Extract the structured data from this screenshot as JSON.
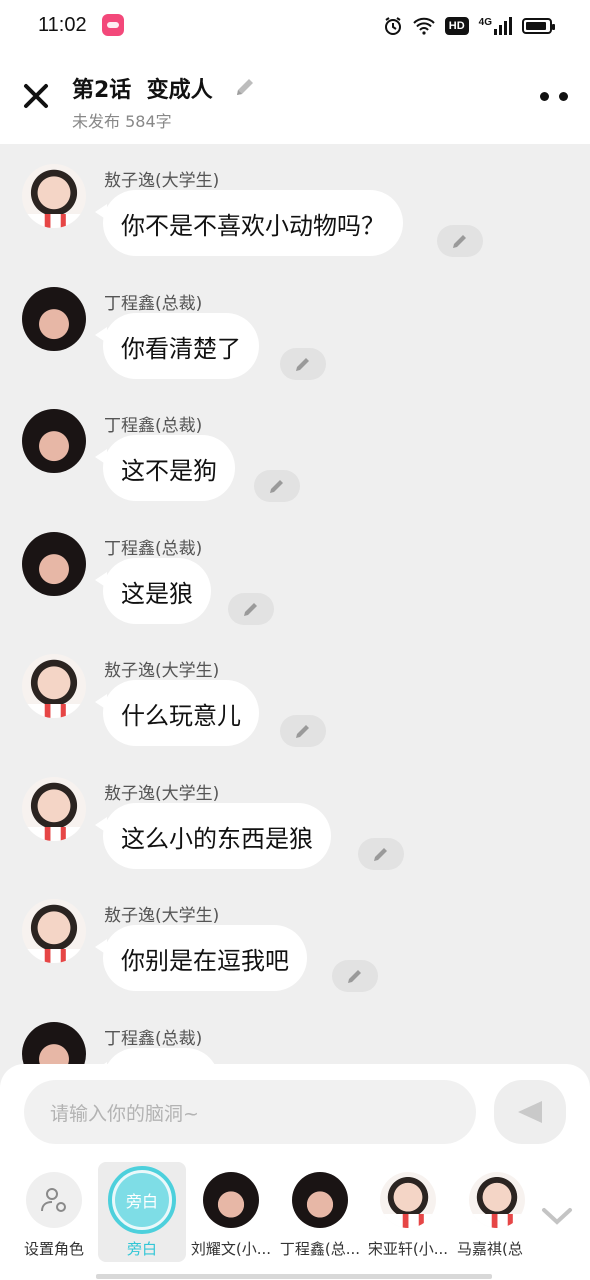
{
  "status_bar": {
    "time": "11:02",
    "signal_label": "4G",
    "hd_label": "HD"
  },
  "header": {
    "title": "第2话  变成人",
    "subtitle": "未发布 584字"
  },
  "messages": [
    {
      "name": "敖子逸(大学生)",
      "text": "你不是不喜欢小动物吗？",
      "avatar": "a"
    },
    {
      "name": "丁程鑫(总裁)",
      "text": "你看清楚了",
      "avatar": "b"
    },
    {
      "name": "丁程鑫(总裁)",
      "text": "这不是狗",
      "avatar": "b"
    },
    {
      "name": "丁程鑫(总裁)",
      "text": "这是狼",
      "avatar": "b"
    },
    {
      "name": "敖子逸(大学生)",
      "text": "什么玩意儿",
      "avatar": "a"
    },
    {
      "name": "敖子逸(大学生)",
      "text": "这么小的东西是狼",
      "avatar": "a"
    },
    {
      "name": "敖子逸(大学生)",
      "text": "你别是在逗我吧",
      "avatar": "a"
    },
    {
      "name": "丁程鑫(总裁)",
      "text": "",
      "avatar": "b"
    }
  ],
  "composer": {
    "placeholder": "请输入你的脑洞~"
  },
  "roles": {
    "set_role": "设置角色",
    "narration_icon": "旁白",
    "narration": "旁白",
    "items": [
      "刘耀文(小...",
      "丁程鑫(总...",
      "宋亚轩(小...",
      "马嘉祺(总"
    ]
  },
  "colors": {
    "accent": "#32c6d6",
    "bubble": "#ffffff",
    "background": "#efefef"
  }
}
